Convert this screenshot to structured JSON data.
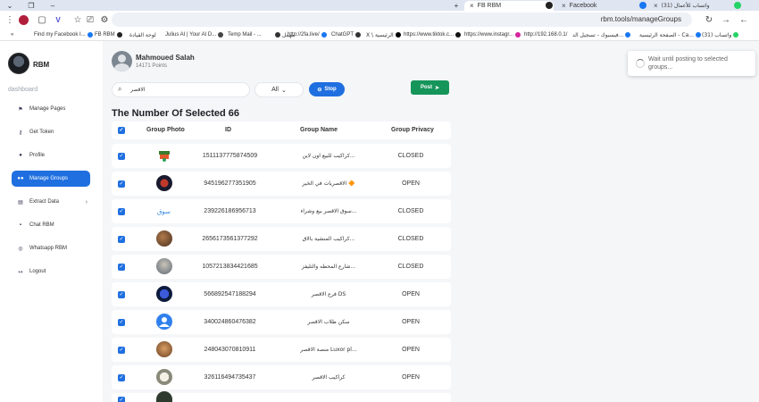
{
  "browser": {
    "tabs": [
      {
        "title": "FB RBM",
        "active": true
      },
      {
        "title": "Facebook",
        "active": false
      },
      {
        "title": "(31) واتساب للأعمال",
        "active": false
      }
    ],
    "url": "rbm.tools/manageGroups",
    "bookmarks": [
      "Find my Facebook I...",
      "FB RBM",
      "لوحة القيادة",
      "Julius AI | Your AI D...",
      "Temp Mail - ...",
      "مهمل",
      "http://2fa.live/",
      "ChatGPT",
      "X \\ الرئيسية",
      "https://www.tiktok.c...",
      "https://www.instagr...",
      "http://192.168.0.1/",
      "فيسبوك - تسجيل الد...",
      "الصفحة الرئيسية - Ca...",
      "واتساب (31)"
    ]
  },
  "sidebar": {
    "brand": "RBM",
    "section": "dashboard",
    "items": [
      {
        "label": "Manage Pages",
        "icon": "flag-icon"
      },
      {
        "label": "Get Token",
        "icon": "key-icon"
      },
      {
        "label": "Profile",
        "icon": "user-icon"
      },
      {
        "label": "Manage Groups",
        "icon": "users-icon",
        "active": true
      },
      {
        "label": "Extract Data",
        "icon": "database-icon",
        "has_submenu": true
      },
      {
        "label": "Chat RBM",
        "icon": "chat-icon"
      },
      {
        "label": "Whatsapp RBM",
        "icon": "whatsapp-icon"
      },
      {
        "label": "Logout",
        "icon": "logout-icon"
      }
    ]
  },
  "user": {
    "name": "Mahmoued Salah",
    "points": "14171 Points"
  },
  "toolbar": {
    "search_value": "الاقصر",
    "filter_value": "All",
    "stop_label": "Stop",
    "post_label": "Post"
  },
  "heading": "The Number Of Selected 66",
  "table": {
    "columns": [
      "Group Photo",
      "ID",
      "Group Name",
      "Group Privacy"
    ],
    "rows": [
      {
        "id": "1511137775874509",
        "name": "كراكيب للبيع اون لاين...",
        "privacy": "CLOSED"
      },
      {
        "id": "945196277351905",
        "name": "الاقصريات في الخير 🔶",
        "privacy": "OPEN"
      },
      {
        "id": "239226186956713",
        "name": "سوق الاقصر بيع وشراء...",
        "privacy": "CLOSED"
      },
      {
        "id": "2656173561377292",
        "name": "كراكيب المنشية بالاق...",
        "privacy": "CLOSED"
      },
      {
        "id": "1057213834421685",
        "name": "شارع المحطه والتليفز...",
        "privacy": "CLOSED"
      },
      {
        "id": "566892547188294",
        "name": "فرع الاقصر DS",
        "privacy": "OPEN"
      },
      {
        "id": "340024860476382",
        "name": "سكن طلاب الاقصر",
        "privacy": "OPEN"
      },
      {
        "id": "248043070810911",
        "name": "منصة الاقصر Luxor pl...",
        "privacy": "OPEN"
      },
      {
        "id": "326116494735437",
        "name": "كراكيب الاقصر",
        "privacy": "OPEN"
      }
    ]
  },
  "toast": {
    "message": "Wait until posting to selected groups..."
  }
}
